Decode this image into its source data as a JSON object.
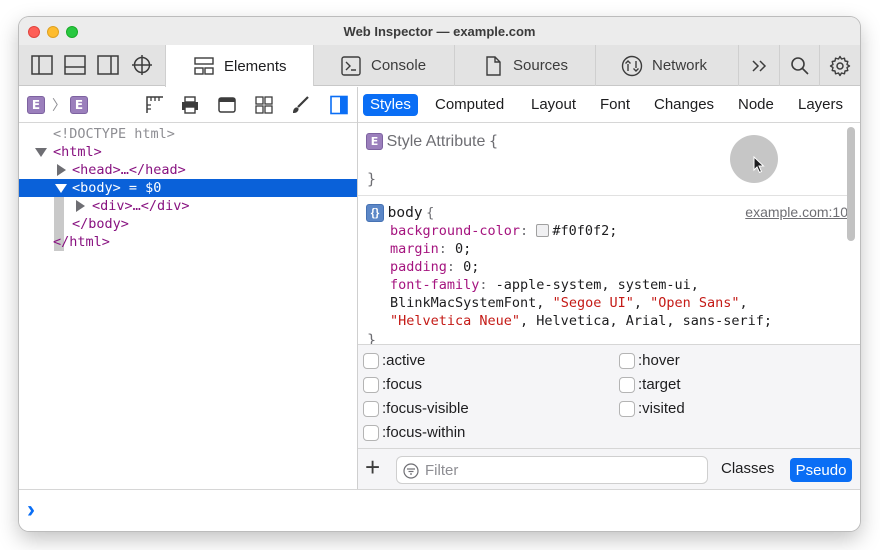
{
  "window": {
    "title": "Web Inspector — example.com"
  },
  "tabs": [
    {
      "label": "Elements",
      "icon": "elements-icon",
      "active": true
    },
    {
      "label": "Console",
      "icon": "console-icon"
    },
    {
      "label": "Sources",
      "icon": "sources-icon"
    },
    {
      "label": "Network",
      "icon": "network-icon"
    }
  ],
  "tabbar_icons": [
    "dock-left-icon",
    "dock-bottom-icon",
    "dock-right-icon",
    "element-picker-icon",
    "more-tabs-icon",
    "search-icon",
    "gear-icon"
  ],
  "breadcrumb": {
    "first_badge": "E",
    "separator": "〉",
    "second_badge": "E"
  },
  "dom_tree": {
    "doctype": "<!DOCTYPE html>",
    "html_open": "<html>",
    "head": "<head>…</head>",
    "body_open": "<body>",
    "body_ref": " = $0",
    "div": "<div>…</div>",
    "body_close": "</body>",
    "html_close": "</html>"
  },
  "sidebar_tabs": [
    "Styles",
    "Computed",
    "Layout",
    "Font",
    "Changes",
    "Node",
    "Layers"
  ],
  "sidebar_active": "Styles",
  "styles": {
    "style_attribute": {
      "badge": "E",
      "label": "Style Attribute",
      "open": "{",
      "close": "}"
    },
    "body_rule": {
      "badge": "{}",
      "selector": "body",
      "open": "{",
      "close": "}",
      "source": "example.com:10",
      "bg_prop": "background-color",
      "bg_value": "#f0f0f2;",
      "margin_prop": "margin",
      "margin_value": "0;",
      "padding_prop": "padding",
      "padding_value": "0;",
      "font_prop": "font-family",
      "font_value_1": "-apple-system, system-ui,",
      "font_value_2a": "BlinkMacSystemFont, ",
      "font_value_2b": "\"Segoe UI\"",
      "font_value_2c": ", ",
      "font_value_2d": "\"Open Sans\"",
      "font_value_2e": ",",
      "font_value_3a": "\"Helvetica Neue\"",
      "font_value_3b": ", Helvetica, Arial, sans-serif;"
    }
  },
  "pseudo_classes": [
    ":active",
    ":hover",
    ":focus",
    ":target",
    ":focus-visible",
    ":visited",
    ":focus-within"
  ],
  "filter": {
    "add": "+",
    "placeholder": "Filter",
    "classes": "Classes",
    "pseudo": "Pseudo"
  },
  "console": {
    "prompt": "›"
  },
  "colors": {
    "accent": "#0a6ef5",
    "selection": "#0a61d9",
    "tag": "#881280",
    "property": "#a5147f",
    "string": "#c41a16",
    "badge": "#9b7fbc"
  }
}
